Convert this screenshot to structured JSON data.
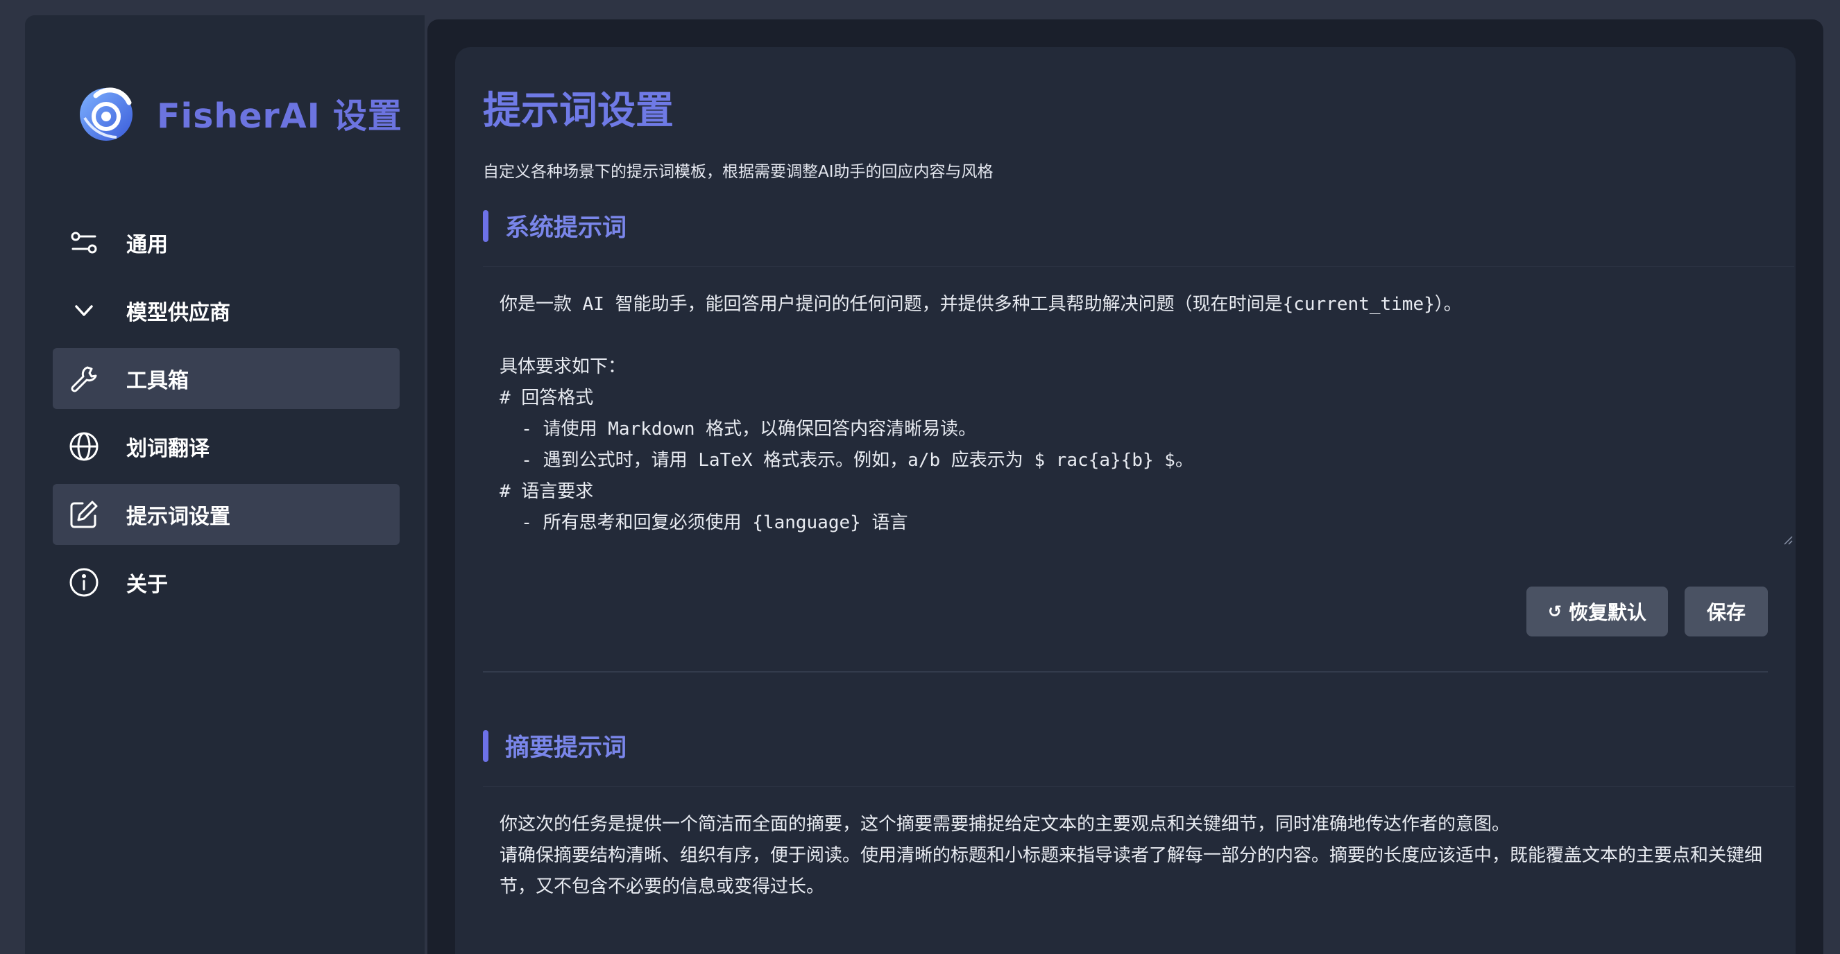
{
  "app": {
    "title": "FisherAI 设置"
  },
  "sidebar": {
    "items": [
      {
        "label": "通用",
        "icon": "sliders-icon",
        "active": false
      },
      {
        "label": "模型供应商",
        "icon": "chevron-down-icon",
        "active": false
      },
      {
        "label": "工具箱",
        "icon": "wrench-icon",
        "active": true
      },
      {
        "label": "划词翻译",
        "icon": "globe-icon",
        "active": false
      },
      {
        "label": "提示词设置",
        "icon": "edit-icon",
        "active": true
      },
      {
        "label": "关于",
        "icon": "info-icon",
        "active": false
      }
    ]
  },
  "main": {
    "title": "提示词设置",
    "description": "自定义各种场景下的提示词模板，根据需要调整AI助手的回应内容与风格",
    "system_prompt": {
      "title": "系统提示词",
      "text": "你是一款 AI 智能助手，能回答用户提问的任何问题，并提供多种工具帮助解决问题（现在时间是{current_time}）。\n\n具体要求如下：\n# 回答格式\n  - 请使用 Markdown 格式，以确保回答内容清晰易读。\n  - 遇到公式时，请用 LaTeX 格式表示。例如，a/b 应表示为 $ rac{a}{b} $。\n# 语言要求\n  - 所有思考和回复必须使用 {language} 语言",
      "reset_label": "恢复默认",
      "save_label": "保存"
    },
    "summary_prompt": {
      "title": "摘要提示词",
      "text": "你这次的任务是提供一个简洁而全面的摘要，这个摘要需要捕捉给定文本的主要观点和关键细节，同时准确地传达作者的意图。\n请确保摘要结构清晰、组织有序，便于阅读。使用清晰的标题和小标题来指导读者了解每一部分的内容。摘要的长度应该适中，既能覆盖文本的主要点和关键细节，又不包含不必要的信息或变得过长。"
    }
  },
  "colors": {
    "accent": "#6d72e8",
    "sidebar_bg": "#222937",
    "panel_bg": "#232a39",
    "button_bg": "#4a5263"
  }
}
